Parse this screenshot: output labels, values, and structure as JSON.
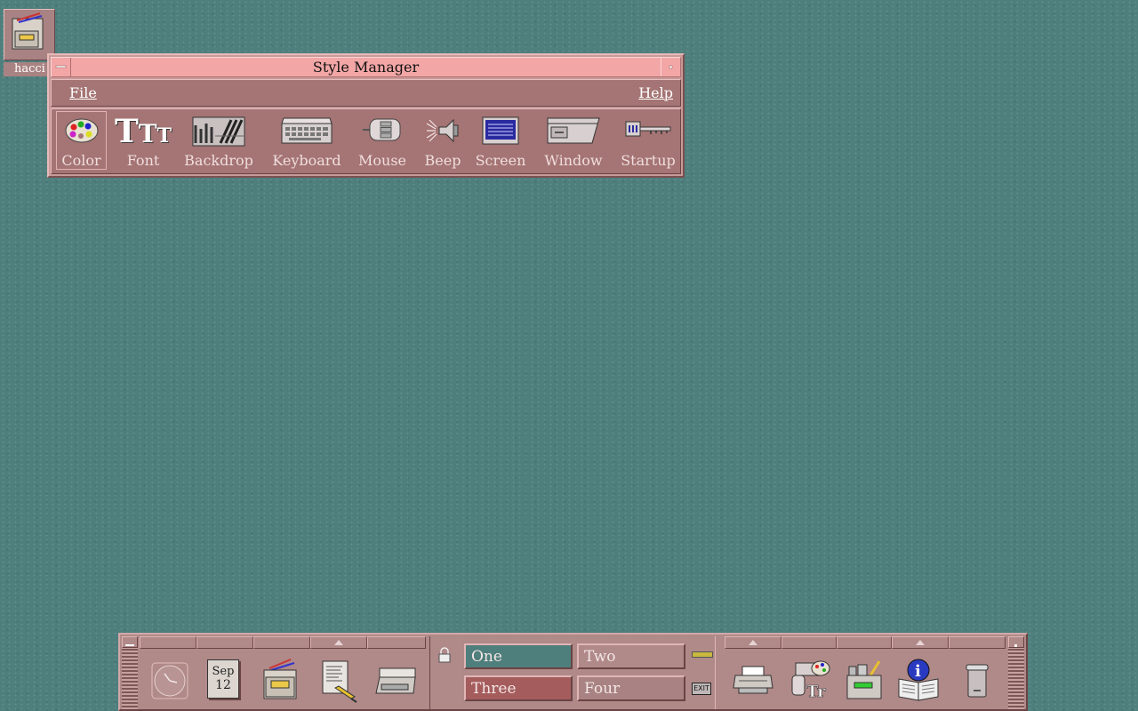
{
  "desktop": {
    "icon_label": "hacci"
  },
  "style_manager": {
    "title": "Style Manager",
    "menu": {
      "file": "File",
      "help": "Help"
    },
    "tools": [
      {
        "label": "Color",
        "icon": "palette-icon",
        "selected": true
      },
      {
        "label": "Font",
        "icon": "font-icon",
        "selected": false
      },
      {
        "label": "Backdrop",
        "icon": "backdrop-icon",
        "selected": false
      },
      {
        "label": "Keyboard",
        "icon": "keyboard-icon",
        "selected": false
      },
      {
        "label": "Mouse",
        "icon": "mouse-icon",
        "selected": false
      },
      {
        "label": "Beep",
        "icon": "speaker-icon",
        "selected": false
      },
      {
        "label": "Screen",
        "icon": "screen-icon",
        "selected": false
      },
      {
        "label": "Window",
        "icon": "window-icon",
        "selected": false
      },
      {
        "label": "Startup",
        "icon": "key-icon",
        "selected": false
      }
    ]
  },
  "front_panel": {
    "calendar": {
      "month": "Sep",
      "day": "12"
    },
    "workspaces": [
      {
        "label": "One",
        "active": true
      },
      {
        "label": "Two",
        "active": false
      },
      {
        "label": "Three",
        "active": false
      },
      {
        "label": "Four",
        "active": false
      }
    ],
    "exit_label": "EXIT",
    "icons": [
      "clock-icon",
      "calendar-icon",
      "file-manager-icon",
      "text-editor-icon",
      "mailbox-icon",
      "lock-icon",
      "busy-light-icon",
      "exit-icon",
      "printer-icon",
      "style-manager-icon",
      "app-manager-icon",
      "help-icon",
      "trash-icon"
    ]
  },
  "colors": {
    "desktop_bg": "#4f7f7c",
    "window_frame": "#c89a9a",
    "title_active": "#f2a6a6",
    "panel": "#b08989",
    "ws_one": "#4f7f7c",
    "ws_two": "#b08989",
    "ws_three": "#a55c5c",
    "ws_four": "#a98383"
  }
}
